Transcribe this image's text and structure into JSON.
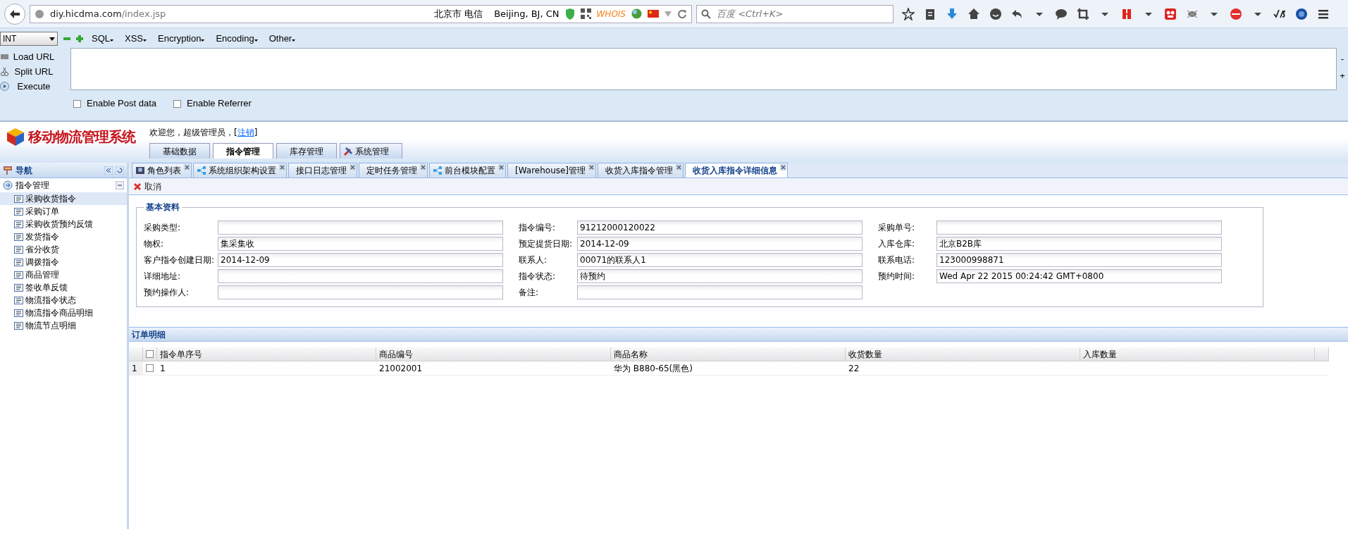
{
  "browser": {
    "url_host": "diy.hicdma.com",
    "url_path": "/index.jsp",
    "location": "北京市 电信",
    "geo": "Beijing, BJ, CN",
    "whois": "WHOIS",
    "search": {
      "placeholder": "百度 <Ctrl+K>"
    }
  },
  "hackbar": {
    "select": "INT",
    "menus": [
      "SQL",
      "XSS",
      "Encryption",
      "Encoding",
      "Other"
    ],
    "actions": [
      "Load URL",
      "Split URL",
      "Execute"
    ],
    "side": [
      "-",
      "+"
    ],
    "options": [
      {
        "label": "Enable Post data",
        "checked": false
      },
      {
        "label": "Enable Referrer",
        "checked": false
      }
    ]
  },
  "app": {
    "logo": "移动物流管理系统",
    "welcome": "欢迎您，超级管理员，[",
    "logout": "注销",
    "welcome_end": "]",
    "menu": [
      {
        "label": "基础数据",
        "selected": false,
        "kind": "plain"
      },
      {
        "label": "指令管理",
        "selected": true,
        "kind": "plain"
      },
      {
        "label": "库存管理",
        "selected": false,
        "kind": "plain"
      },
      {
        "label": "系统管理",
        "selected": false,
        "kind": "tool"
      }
    ]
  },
  "nav": {
    "title": "导航",
    "group": "指令管理",
    "items": [
      {
        "label": "采购收货指令",
        "selected": true
      },
      {
        "label": "采购订单",
        "selected": false
      },
      {
        "label": "采购收货预约反馈",
        "selected": false
      },
      {
        "label": "发货指令",
        "selected": false
      },
      {
        "label": "省分收货",
        "selected": false
      },
      {
        "label": "调拨指令",
        "selected": false
      },
      {
        "label": "商品管理",
        "selected": false
      },
      {
        "label": "签收单反馈",
        "selected": false
      },
      {
        "label": "物流指令状态",
        "selected": false
      },
      {
        "label": "物流指令商品明细",
        "selected": false
      },
      {
        "label": "物流节点明细",
        "selected": false
      }
    ]
  },
  "tabs": [
    {
      "label": "角色列表",
      "selected": false,
      "kind": "users"
    },
    {
      "label": "系统组织架构设置",
      "selected": false,
      "kind": "tree"
    },
    {
      "label": "接口日志管理",
      "selected": false,
      "kind": "plain"
    },
    {
      "label": "定时任务管理",
      "selected": false,
      "kind": "plain"
    },
    {
      "label": "前台模块配置",
      "selected": false,
      "kind": "tree"
    },
    {
      "label": "[Warehouse]管理",
      "selected": false,
      "kind": "plain"
    },
    {
      "label": "收货入库指令管理",
      "selected": false,
      "kind": "plain"
    },
    {
      "label": "收货入库指令详细信息",
      "selected": true,
      "kind": "plain"
    }
  ],
  "toolbar": {
    "cancel": "取消"
  },
  "form": {
    "legend": "基本资料",
    "fields": [
      {
        "label": "采购类型:"
      },
      {
        "label": "指令编号:",
        "value": "91212000120022"
      },
      {
        "label": "采购单号:"
      },
      {
        "label": "物权:",
        "value": "集采集收"
      },
      {
        "label": "预定提货日期:",
        "value": "2014-12-09"
      },
      {
        "label": "入库仓库:",
        "value": "北京B2B库"
      },
      {
        "label": "客户指令创建日期:",
        "value": "2014-12-09"
      },
      {
        "label": "联系人:",
        "value": "00071的联系人1"
      },
      {
        "label": "联系电话:",
        "value": "123000998871"
      },
      {
        "label": "详细地址:"
      },
      {
        "label": "指令状态:",
        "value": "待预约"
      },
      {
        "label": "预约时间:",
        "value": "Wed Apr 22 2015 00:24:42 GMT+0800"
      },
      {
        "label": "预约操作人:"
      },
      {
        "label": "备注:"
      }
    ]
  },
  "grid": {
    "title": "订单明细",
    "header_checked": false,
    "columns": [
      "指令单序号",
      "商品编号",
      "商品名称",
      "收货数量",
      "入库数量"
    ],
    "rows": [
      {
        "number": "1",
        "checked": false,
        "cells": [
          "1",
          "21002001",
          "华为 B880-65(黑色)",
          "22"
        ]
      }
    ]
  }
}
